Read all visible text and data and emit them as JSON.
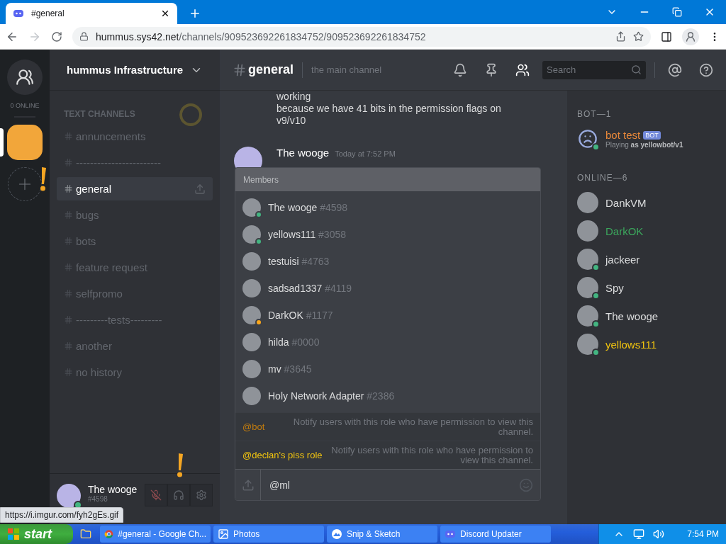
{
  "browser": {
    "tab_title": "#general",
    "url_host": "hummus.sys42.net",
    "url_path": "/channels/909523692261834752/909523692261834752",
    "forward_disabled": true
  },
  "servers": {
    "online_label": "0 ONLINE",
    "items": [
      {
        "selected": true
      }
    ]
  },
  "sidebar": {
    "server_name": "hummus Infrastructure",
    "category": "TEXT CHANNELS",
    "channels": [
      {
        "name": "annuncements",
        "selected": false
      },
      {
        "name": "------------------------",
        "selected": false
      },
      {
        "name": "general",
        "selected": true
      },
      {
        "name": "bugs",
        "selected": false
      },
      {
        "name": "bots",
        "selected": false
      },
      {
        "name": "feature request",
        "selected": false
      },
      {
        "name": "selfpromo",
        "selected": false
      },
      {
        "name": "---------tests---------",
        "selected": false
      },
      {
        "name": "another",
        "selected": false
      },
      {
        "name": "no history",
        "selected": false
      }
    ],
    "user": {
      "name": "The wooge",
      "tag": "#4598",
      "dot": {
        "color": "#43b581"
      }
    }
  },
  "chat": {
    "channel": "general",
    "topic": "the main channel",
    "search_placeholder": "Search",
    "messages": [
      {
        "kind": "text",
        "text": "working"
      },
      {
        "kind": "text",
        "text": "because we have 41 bits in the permission flags on v9/v10"
      },
      {
        "kind": "header",
        "author": "The wooge",
        "time": "Today at 7:52 PM"
      }
    ]
  },
  "autocomplete": {
    "title": "Members",
    "members": [
      {
        "name": "The wooge",
        "tag": "#4598",
        "dot": {
          "color": "#43b581"
        }
      },
      {
        "name": "yellows111",
        "tag": "#3058",
        "dot": {
          "color": "#43b581"
        }
      },
      {
        "name": "testuisi",
        "tag": "#4763"
      },
      {
        "name": "sadsad1337",
        "tag": "#4119"
      },
      {
        "name": "DarkOK",
        "tag": "#1177",
        "dot": {
          "color": "#faa61a"
        }
      },
      {
        "name": "hilda",
        "tag": "#0000"
      },
      {
        "name": "mv",
        "tag": "#3645"
      },
      {
        "name": "Holy Network Adapter",
        "tag": "#2386"
      }
    ],
    "roles": [
      {
        "name": "@bot",
        "color": "#c27c0e",
        "description": "Notify users with this role who have permission to view this channel."
      },
      {
        "name": "@declan's piss role",
        "color": "#f1c40f",
        "description": "Notify users with this role who have permission to view this channel."
      }
    ],
    "input_value": "@ml"
  },
  "member_list": {
    "sections": [
      {
        "heading": "BOT—1",
        "members": [
          {
            "name": "bot test",
            "color": "#e8883a",
            "dot": {
              "color": "#43b581"
            },
            "bot_tag": "BOT",
            "activity": "Playing **as yellowbot/v1**"
          }
        ]
      },
      {
        "heading": "ONLINE—6",
        "members": [
          {
            "name": "DankVM",
            "color": "#dcddde"
          },
          {
            "name": "DarkOK",
            "color": "#3ba55c"
          },
          {
            "name": "jackeer",
            "color": "#dcddde",
            "dot": {
              "color": "#43b581"
            }
          },
          {
            "name": "Spy",
            "color": "#dcddde",
            "dot": {
              "color": "#43b581"
            }
          },
          {
            "name": "The wooge",
            "color": "#dcddde",
            "dot": {
              "color": "#43b581"
            }
          },
          {
            "name": "yellows111",
            "color": "#f1c40f",
            "dot": {
              "color": "#43b581"
            }
          }
        ]
      }
    ]
  },
  "status_url": "https://i.imgur.com/fyh2gEs.gif",
  "taskbar": {
    "start": "start",
    "items": [
      {
        "kind": "explorer"
      },
      {
        "kind": "chrome",
        "label": "#general - Google Ch..."
      },
      {
        "kind": "photos",
        "label": "Photos"
      },
      {
        "kind": "snip",
        "label": "Snip & Sketch"
      },
      {
        "kind": "discord",
        "label": "Discord Updater"
      }
    ],
    "clock": "7:54 PM"
  }
}
